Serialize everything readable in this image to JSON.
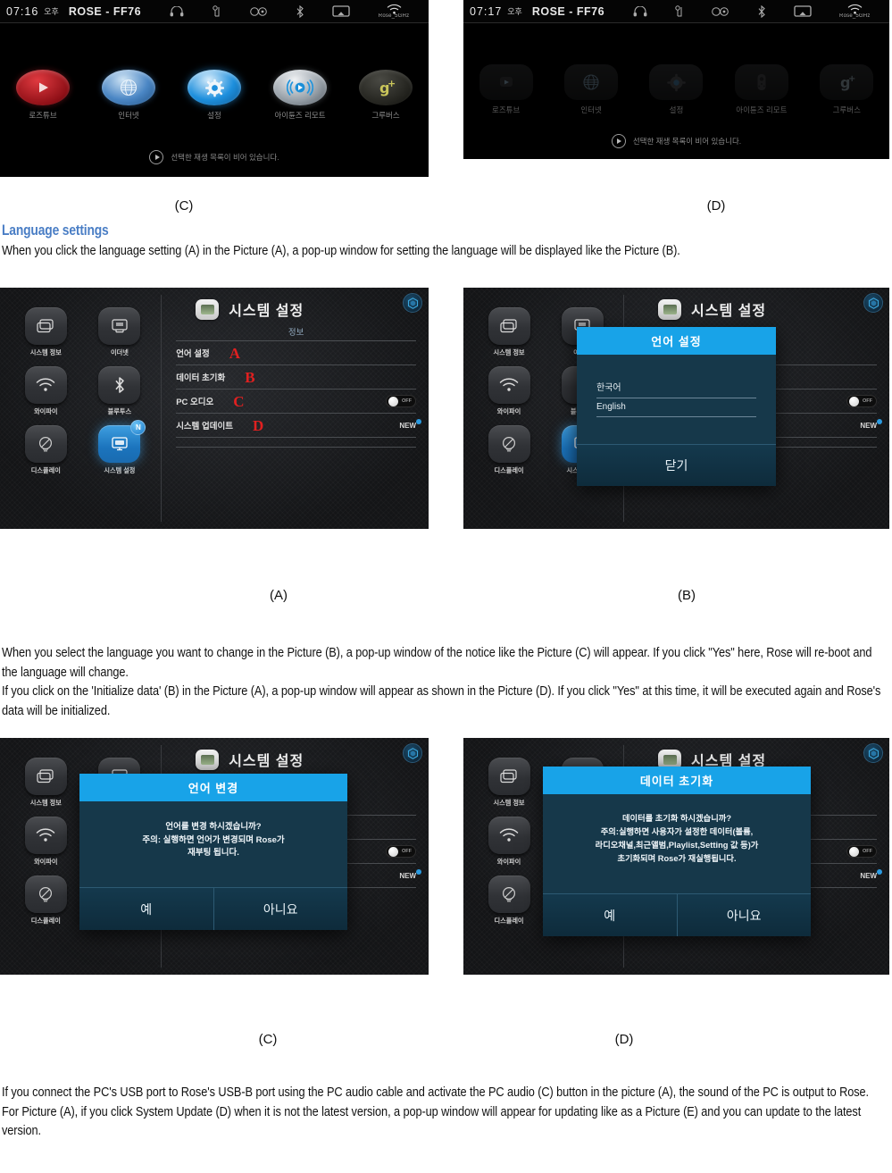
{
  "document": {
    "section_heading": "Language settings",
    "paragraph_1": "When you click the language setting (A) in the Picture (A), a pop-up window for setting the language will be displayed like the Picture (B).",
    "paragraph_2": "When you select the language you want to change in the Picture (B), a pop-up window of the notice like the Picture (C) will appear. If you click \"Yes\" here, Rose will re-boot and the language will change.\nIf you click on the 'Initialize data' (B) in the Picture (A), a pop-up window will appear as shown in the Picture (D). If you click \"Yes\" at this time, it will be executed again and Rose's data will be initialized.",
    "paragraph_3": "If you connect the PC's USB port to Rose's USB-B port using the PC audio cable and activate the PC audio (C) button in the picture (A), the sound of the PC is output to Rose.\nFor Picture (A), if you click System Update (D) when it is not the latest version, a pop-up window will appear for updating like as a Picture (E) and you can update to the latest version."
  },
  "captions": {
    "row1_left": "(C)",
    "row1_right": "(D)",
    "row2_left": "(A)",
    "row2_right": "(B)",
    "row3_left": "(C)",
    "row3_right": "(D)"
  },
  "home_screen_c": {
    "status": {
      "time": "07:16",
      "ampm": "오후",
      "device_name": "ROSE - FF76",
      "wifi_ssid": "Rose_5GHz",
      "icons": [
        "headphone-icon",
        "usb-icon",
        "disc-icon",
        "bluetooth-icon",
        "display-cast-icon",
        "wifi-icon"
      ]
    },
    "apps": [
      {
        "label": "로즈튜브",
        "icon": "play-triangle-icon",
        "color": "#b81c22"
      },
      {
        "label": "인터넷",
        "icon": "globe-icon",
        "color": "#2f6fb5"
      },
      {
        "label": "설정",
        "icon": "gear-icon",
        "color": "#1d8fdd"
      },
      {
        "label": "아이튠즈 리모트",
        "icon": "itunes-remote-icon",
        "color": "#9aa3ab"
      },
      {
        "label": "그루버스",
        "icon": "g-plus-icon",
        "color": "#2a2a26"
      }
    ],
    "bottom_message": "선택한 재생 목록이 비어 있습니다."
  },
  "home_screen_d": {
    "status": {
      "time": "07:17",
      "ampm": "오후",
      "device_name": "ROSE - FF76",
      "wifi_ssid": "Rose_5GHz",
      "icons": [
        "headphone-icon",
        "usb-icon",
        "disc-icon",
        "bluetooth-icon",
        "display-cast-icon",
        "wifi-icon"
      ]
    },
    "apps": [
      {
        "label": "로즈튜브",
        "icon": "play-triangle-icon",
        "color": "#b81c22"
      },
      {
        "label": "인터넷",
        "icon": "globe-icon",
        "color": "#2f6fb5"
      },
      {
        "label": "설정",
        "icon": "gear-icon",
        "color": "#1d8fdd"
      },
      {
        "label": "아이튠즈 리모트",
        "icon": "itunes-remote-icon",
        "color": "#9aa3ab"
      },
      {
        "label": "그루버스",
        "icon": "g-plus-icon",
        "color": "#2a2a26"
      }
    ],
    "bottom_message": "선택한 재생 목록이 비어 있습니다."
  },
  "settings_screen": {
    "title": "시스템 설정",
    "tab": "정보",
    "sidebar": [
      {
        "label": "시스템 정보",
        "icon": "windows-stack-icon"
      },
      {
        "label": "이더넷",
        "icon": "ethernet-icon"
      },
      {
        "label": "와이파이",
        "icon": "wifi-icon"
      },
      {
        "label": "블루투스",
        "icon": "bluetooth-icon"
      },
      {
        "label": "디스플레이",
        "icon": "display-brightness-icon"
      },
      {
        "label": "시스템 설정",
        "icon": "monitor-icon",
        "selected": true,
        "badge": "N"
      }
    ],
    "rows": [
      {
        "label": "언어 설정",
        "mark": "A"
      },
      {
        "label": "데이터 초기화",
        "mark": "B"
      },
      {
        "label": "PC 오디오",
        "mark": "C",
        "toggle": "OFF"
      },
      {
        "label": "시스템 업데이트",
        "mark": "D",
        "badge": "NEW"
      }
    ],
    "logo": "rose-hex-logo-icon"
  },
  "language_popup": {
    "title": "언어 설정",
    "options": [
      "한국어",
      "English"
    ],
    "close_label": "닫기"
  },
  "language_change_dialog": {
    "title": "언어 변경",
    "message": "언어를 변경 하시겠습니까?\n주의: 실행하면 언어가 변경되며 Rose가\n재부팅 됩니다.",
    "yes_label": "예",
    "no_label": "아니요"
  },
  "data_init_dialog": {
    "title": "데이터 초기화",
    "message": "데이터를 초기화 하시겠습니까?\n주의:실행하면 사용자가 설정한 데이터(볼륨,\n라디오채널,최근앨범,Playlist,Setting 값 등)가\n초기화되며 Rose가 재실행됩니다.",
    "yes_label": "예",
    "no_label": "아니요"
  },
  "colors": {
    "heading_blue": "#4a7ec5",
    "modal_header": "#18a3e8",
    "modal_body": "#16384a",
    "accent_red": "#e02020"
  }
}
